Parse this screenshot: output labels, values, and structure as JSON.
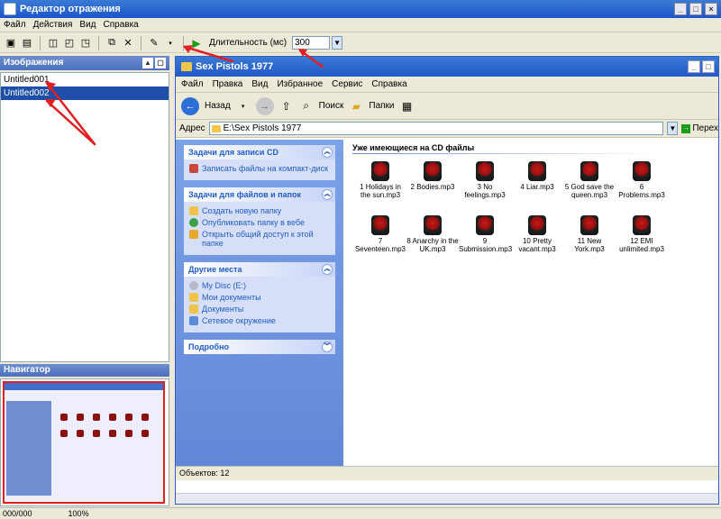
{
  "app": {
    "title": "Редактор отражения"
  },
  "menu": [
    "Файл",
    "Действия",
    "Вид",
    "Справка"
  ],
  "toolbar": {
    "duration_label": "Длительность (мс)",
    "duration_value": "300"
  },
  "left_panel": {
    "header": "Изображения",
    "images": [
      "Untitled001",
      "Untitled002"
    ]
  },
  "navigator": {
    "header": "Навигатор"
  },
  "status": {
    "coords": "000/000",
    "zoom": "100%"
  },
  "explorer": {
    "title": "Sex Pistols 1977",
    "menu": [
      "Файл",
      "Правка",
      "Вид",
      "Избранное",
      "Сервис",
      "Справка"
    ],
    "toolbar": {
      "back_label": "Назад",
      "search_label": "Поиск",
      "folders_label": "Папки"
    },
    "address_label": "Адрес",
    "address_value": "E:\\Sex Pistols 1977",
    "go_label": "Перех",
    "tasks": [
      {
        "header": "Задачи для записи CD",
        "items": [
          "Записать файлы на компакт-диск"
        ]
      },
      {
        "header": "Задачи для файлов и папок",
        "items": [
          "Создать новую папку",
          "Опубликовать папку в вебе",
          "Открыть общий доступ к этой папке"
        ]
      },
      {
        "header": "Другие места",
        "items": [
          "My Disc (E:)",
          "Мои документы",
          "Документы",
          "Сетевое окружение"
        ]
      },
      {
        "header": "Подробно",
        "items": []
      }
    ],
    "files_header": "Уже имеющиеся на CD файлы",
    "files": [
      "1 Holidays in the sun.mp3",
      "2 Bodies.mp3",
      "3 No feelings.mp3",
      "4 Liar.mp3",
      "5 God save the queen.mp3",
      "6 Problems.mp3",
      "7 Seventeen.mp3",
      "8 Anarchy in the UK.mp3",
      "9 Submission.mp3",
      "10 Pretty vacant.mp3",
      "11 New York.mp3",
      "12 EMI unlimited.mp3"
    ],
    "status": "Объектов: 12"
  },
  "colors": {
    "accent": "#1c55c8",
    "annotation": "#e02020"
  }
}
